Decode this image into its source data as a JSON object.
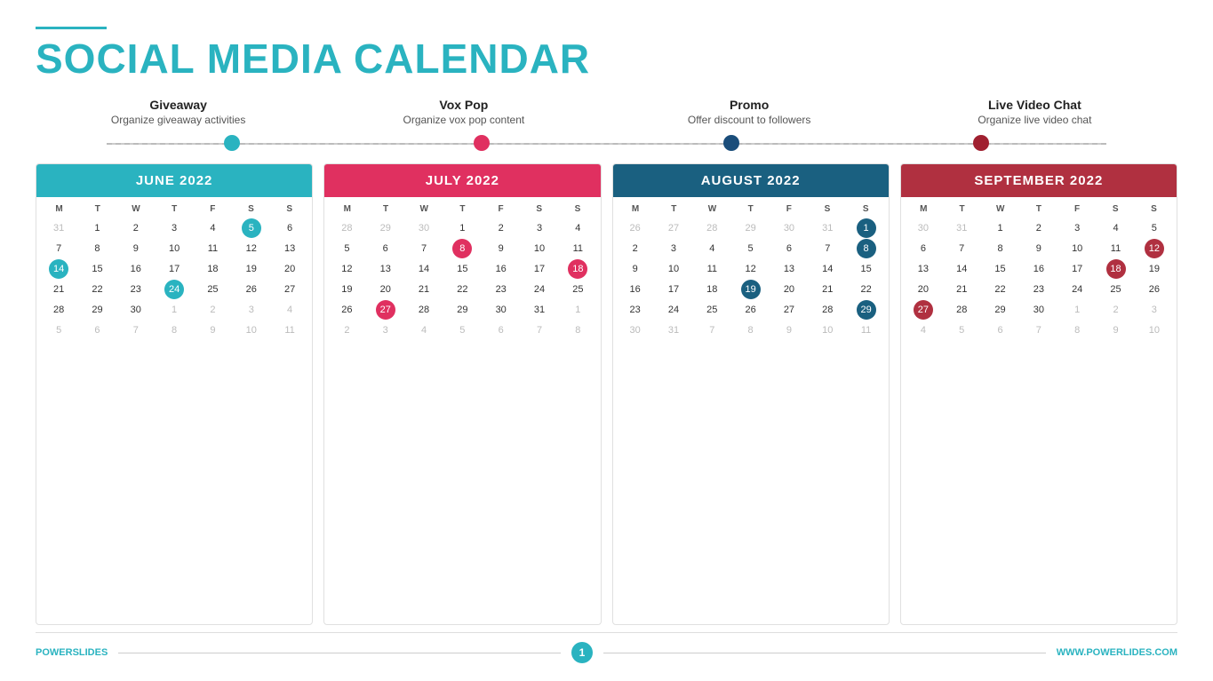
{
  "header": {
    "line_color": "#2ab3c0",
    "title_part1": "SOCIAL MEDIA ",
    "title_part2": "CALENDAR"
  },
  "categories": [
    {
      "id": "giveaway",
      "title": "Giveaway",
      "desc": "Organize giveaway activities",
      "dot_color": "blue"
    },
    {
      "id": "voxpop",
      "title": "Vox Pop",
      "desc": "Organize vox pop content",
      "dot_color": "red"
    },
    {
      "id": "promo",
      "title": "Promo",
      "desc": "Offer discount to followers",
      "dot_color": "darkblue"
    },
    {
      "id": "livevideo",
      "title": "Live Video Chat",
      "desc": "Organize live video chat",
      "dot_color": "darkred"
    }
  ],
  "calendars": [
    {
      "id": "june2022",
      "title": "JUNE 2022",
      "header_class": "cal-header-blue",
      "days": [
        "M",
        "T",
        "W",
        "T",
        "F",
        "S",
        "S"
      ],
      "rows": [
        [
          "31",
          "1",
          "2",
          "3",
          "4",
          "5",
          "6"
        ],
        [
          "7",
          "8",
          "9",
          "10",
          "11",
          "12",
          "13"
        ],
        [
          "14",
          "15",
          "16",
          "17",
          "18",
          "19",
          "20"
        ],
        [
          "21",
          "22",
          "23",
          "24",
          "25",
          "26",
          "27"
        ],
        [
          "28",
          "29",
          "30",
          "1",
          "2",
          "3",
          "4"
        ],
        [
          "5",
          "6",
          "7",
          "8",
          "9",
          "10",
          "11"
        ]
      ],
      "highlights": {
        "blue": [
          [
            "0",
            "5"
          ],
          [
            "2",
            "0"
          ],
          [
            "3",
            "3"
          ]
        ],
        "note": "row0col5=5(blue), row2col0=14(blue), row3col3=24(blue), row1-row5 others normal"
      },
      "highlight_map": {
        "0-5": "blue",
        "2-0": "blue",
        "3-3": "blue"
      },
      "other_month_cells": [
        "0-0",
        "4-3",
        "4-4",
        "4-5",
        "4-6",
        "5-0",
        "5-1",
        "5-2",
        "5-3",
        "5-4",
        "5-5",
        "5-6"
      ]
    },
    {
      "id": "july2022",
      "title": "JULY 2022",
      "header_class": "cal-header-red",
      "days": [
        "M",
        "T",
        "W",
        "T",
        "F",
        "S",
        "S"
      ],
      "rows": [
        [
          "28",
          "29",
          "30",
          "1",
          "2",
          "3",
          "4"
        ],
        [
          "5",
          "6",
          "7",
          "8",
          "9",
          "10",
          "11"
        ],
        [
          "12",
          "13",
          "14",
          "15",
          "16",
          "17",
          "18"
        ],
        [
          "19",
          "20",
          "21",
          "22",
          "23",
          "24",
          "25"
        ],
        [
          "26",
          "27",
          "28",
          "29",
          "30",
          "31",
          "1"
        ],
        [
          "2",
          "3",
          "4",
          "5",
          "6",
          "7",
          "8"
        ]
      ],
      "highlight_map": {
        "1-3": "red",
        "2-6": "red",
        "4-1": "red"
      },
      "other_month_cells": [
        "0-0",
        "0-1",
        "0-2",
        "4-6",
        "5-0",
        "5-1",
        "5-2",
        "5-3",
        "5-4",
        "5-5",
        "5-6"
      ]
    },
    {
      "id": "aug2022",
      "title": "AUGUST 2022",
      "header_class": "cal-header-darkblue",
      "days": [
        "M",
        "T",
        "W",
        "T",
        "F",
        "S",
        "S"
      ],
      "rows": [
        [
          "26",
          "27",
          "28",
          "29",
          "30",
          "31",
          "1"
        ],
        [
          "2",
          "3",
          "4",
          "5",
          "6",
          "7",
          "8"
        ],
        [
          "9",
          "10",
          "11",
          "12",
          "13",
          "14",
          "15"
        ],
        [
          "16",
          "17",
          "18",
          "19",
          "20",
          "21",
          "22"
        ],
        [
          "23",
          "24",
          "25",
          "26",
          "27",
          "28",
          "29"
        ],
        [
          "30",
          "31",
          "7",
          "8",
          "9",
          "10",
          "11"
        ]
      ],
      "highlight_map": {
        "0-6": "darkblue",
        "1-6": "darkblue",
        "3-3": "darkblue",
        "4-6": "darkblue"
      },
      "other_month_cells": [
        "0-0",
        "0-1",
        "0-2",
        "0-3",
        "0-4",
        "0-5",
        "5-0",
        "5-1",
        "5-2",
        "5-3",
        "5-4",
        "5-5",
        "5-6"
      ]
    },
    {
      "id": "sep2022",
      "title": "SEPTEMBER 2022",
      "header_class": "cal-header-darkred",
      "days": [
        "M",
        "T",
        "W",
        "T",
        "F",
        "S",
        "S"
      ],
      "rows": [
        [
          "30",
          "31",
          "1",
          "2",
          "3",
          "4",
          "5"
        ],
        [
          "6",
          "7",
          "8",
          "9",
          "10",
          "11",
          "12"
        ],
        [
          "13",
          "14",
          "15",
          "16",
          "17",
          "18",
          "19"
        ],
        [
          "20",
          "21",
          "22",
          "23",
          "24",
          "25",
          "26"
        ],
        [
          "27",
          "28",
          "29",
          "30",
          "1",
          "2",
          "3"
        ],
        [
          "4",
          "5",
          "6",
          "7",
          "8",
          "9",
          "10"
        ]
      ],
      "highlight_map": {
        "1-6": "darkred",
        "2-5": "darkred",
        "4-0": "darkred"
      },
      "other_month_cells": [
        "0-0",
        "0-1",
        "4-4",
        "4-5",
        "4-6",
        "5-0",
        "5-1",
        "5-2",
        "5-3",
        "5-4",
        "5-5",
        "5-6"
      ]
    }
  ],
  "footer": {
    "left_text1": "POWER",
    "left_text2": "SLIDES",
    "page_number": "1",
    "right_text": "WWW.POWERLIDES.COM"
  }
}
